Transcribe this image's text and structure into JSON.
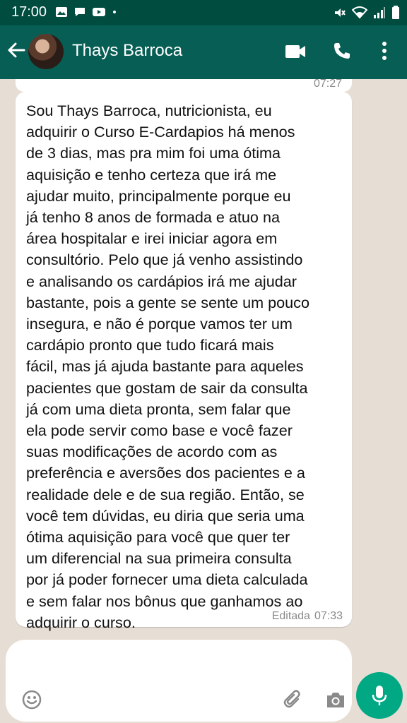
{
  "status_bar": {
    "time": "17:00"
  },
  "header": {
    "contact_name": "Thays Barroca"
  },
  "chat": {
    "previous_message_time": "07:27",
    "message": {
      "lines": [
        "Sou Thays Barroca, nutricionista, eu",
        "adquirir o Curso E-Cardapios há menos",
        "de 3 dias, mas pra mim foi uma ótima",
        "aquisição e tenho certeza que irá me",
        "ajudar muito, principalmente porque eu",
        "já tenho 8 anos de formada e atuo na",
        "área hospitalar e irei iniciar agora em",
        "consultório. Pelo que já venho assistindo",
        "e analisando os cardápios irá me ajudar",
        "bastante, pois a gente se sente um pouco",
        "insegura, e não é porque vamos ter um",
        "cardápio pronto que tudo ficará mais",
        "fácil, mas já ajuda bastante para aqueles",
        "pacientes que gostam de sair da consulta",
        "já com uma dieta pronta, sem falar que",
        "ela pode servir como base e você fazer",
        "suas modificações de acordo com as",
        "preferência e aversões dos pacientes e a",
        "realidade dele e de sua região. Então, se",
        "você tem dúvidas, eu diria que seria uma",
        "ótima aquisição para você que quer ter",
        "um diferencial na sua primeira consulta",
        "por já poder fornecer uma dieta calculada",
        "e sem falar nos bônus que ganhamos ao",
        "adquirir o curso."
      ],
      "edited_label": "Editada",
      "time": "07:33"
    }
  },
  "icons": {
    "back": "arrow-left",
    "video": "video-camera",
    "call": "phone",
    "menu": "more-vertical",
    "emoji": "smiley",
    "attach": "paperclip",
    "camera": "camera",
    "mic": "microphone"
  },
  "colors": {
    "header": "#075e54",
    "status_bar": "#004d40",
    "accent": "#00a884",
    "chat_background": "#e6ddd4",
    "bubble": "#ffffff"
  }
}
